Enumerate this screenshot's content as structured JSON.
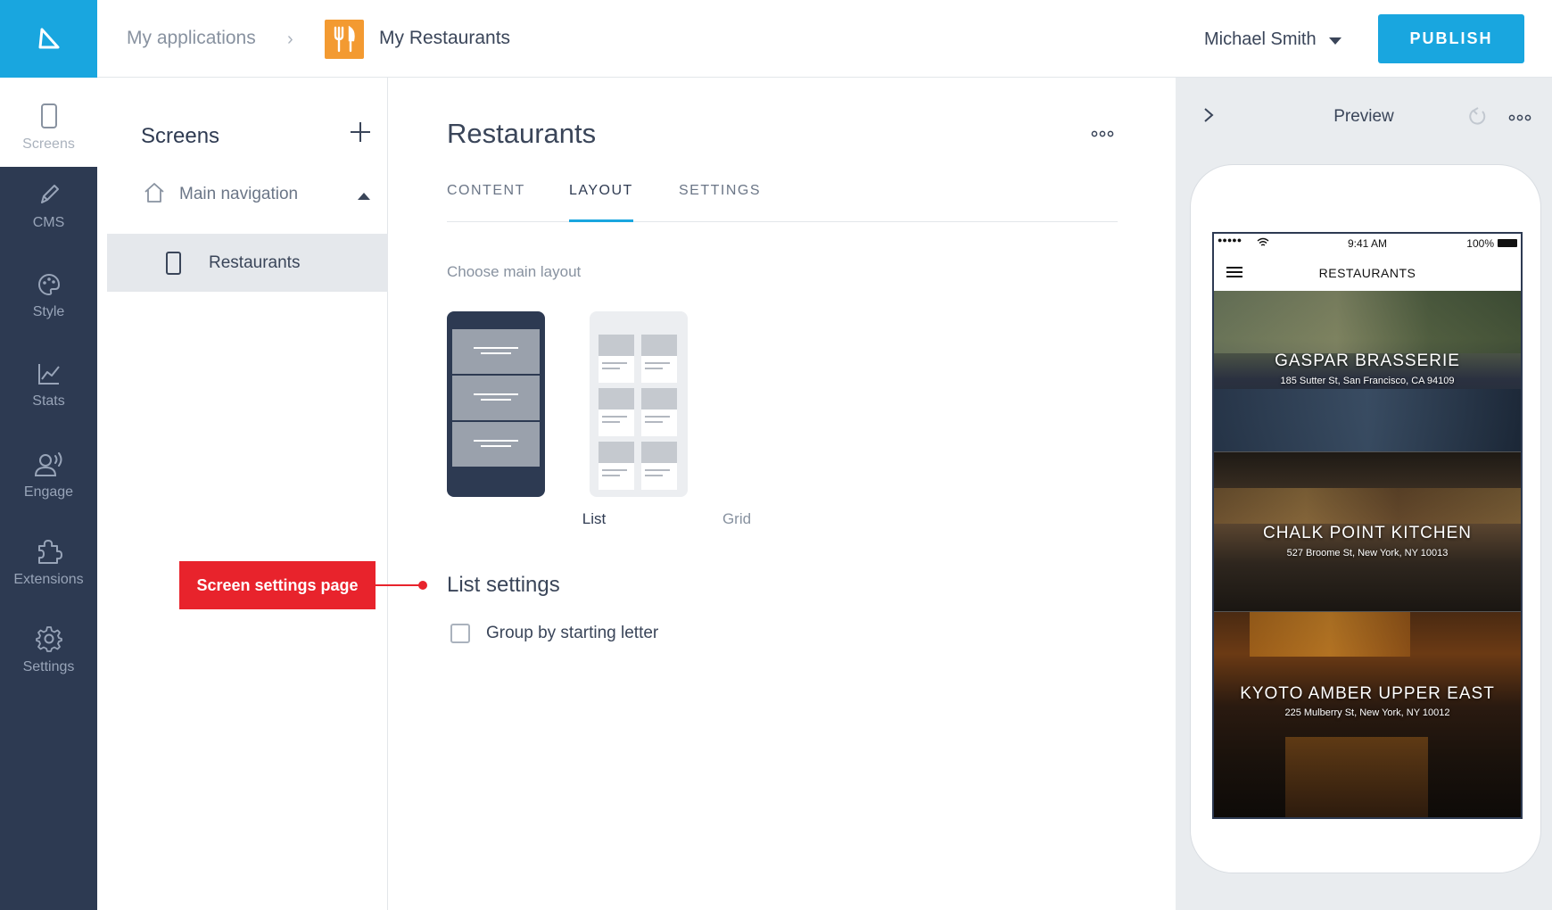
{
  "header": {
    "breadcrumb_root": "My applications",
    "breadcrumb_sep": "›",
    "app_name": "My Restaurants",
    "user_name": "Michael Smith",
    "publish_label": "PUBLISH"
  },
  "sidebar": {
    "items": [
      {
        "label": "Screens",
        "icon": "phone-icon",
        "active": true
      },
      {
        "label": "CMS",
        "icon": "pencil-icon"
      },
      {
        "label": "Style",
        "icon": "palette-icon"
      },
      {
        "label": "Stats",
        "icon": "chart-icon"
      },
      {
        "label": "Engage",
        "icon": "broadcast-user-icon"
      },
      {
        "label": "Extensions",
        "icon": "puzzle-icon"
      },
      {
        "label": "Settings",
        "icon": "gear-icon"
      }
    ]
  },
  "screens_panel": {
    "title": "Screens",
    "nav_group": "Main navigation",
    "screen_item": "Restaurants"
  },
  "main": {
    "title": "Restaurants",
    "tabs": [
      {
        "label": "CONTENT"
      },
      {
        "label": "LAYOUT",
        "active": true
      },
      {
        "label": "SETTINGS"
      }
    ],
    "choose_layout_label": "Choose main layout",
    "layouts": [
      {
        "label": "List",
        "selected": true
      },
      {
        "label": "Grid"
      }
    ],
    "list_settings_title": "List settings",
    "group_by_label": "Group by starting letter",
    "group_by_checked": false
  },
  "annotation": {
    "label": "Screen settings page",
    "color": "#e8232c"
  },
  "preview": {
    "title": "Preview",
    "status_time": "9:41 AM",
    "status_battery": "100%",
    "status_signal": "●●●●●",
    "app_title": "RESTAURANTS",
    "restaurants": [
      {
        "name": "GASPAR BRASSERIE",
        "address": "185 Sutter St, San Francisco, CA 94109"
      },
      {
        "name": "CHALK POINT KITCHEN",
        "address": "527 Broome St, New York, NY 10013"
      },
      {
        "name": "KYOTO AMBER UPPER EAST",
        "address": "225 Mulberry St, New York, NY 10012"
      }
    ]
  },
  "colors": {
    "accent": "#19a6df",
    "sidebar_bg": "#2d3a52",
    "app_icon": "#f39a31"
  }
}
